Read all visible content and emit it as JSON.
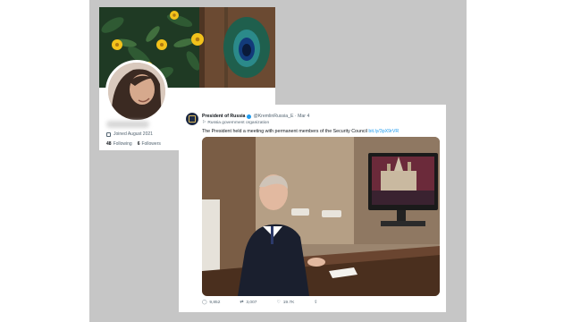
{
  "profile": {
    "joined": "Joined August 2021",
    "following_count": "48",
    "following_label": "Following",
    "followers_count": "6",
    "followers_label": "Followers"
  },
  "tweet": {
    "display_name": "President of Russia",
    "handle_time": "@KremlinRussia_E · Mar 4",
    "account_label": "Russia government organization",
    "text": "The President held a meeting with permanent members of the Security Council",
    "link": "bit.ly/3pX9rVR",
    "replies": "9,852",
    "retweets": "3,007",
    "likes": "19.7K"
  },
  "icons": {
    "calendar": "calendar-icon",
    "verified": "verified-badge-icon",
    "flag": "flag-icon",
    "reply": "reply-icon",
    "retweet": "retweet-icon",
    "like": "heart-icon",
    "share": "share-icon"
  },
  "colors": {
    "backdrop": "#c6c6c6",
    "twitter_blue": "#1d9bf0",
    "text_primary": "#0f1419",
    "text_secondary": "#536471"
  }
}
